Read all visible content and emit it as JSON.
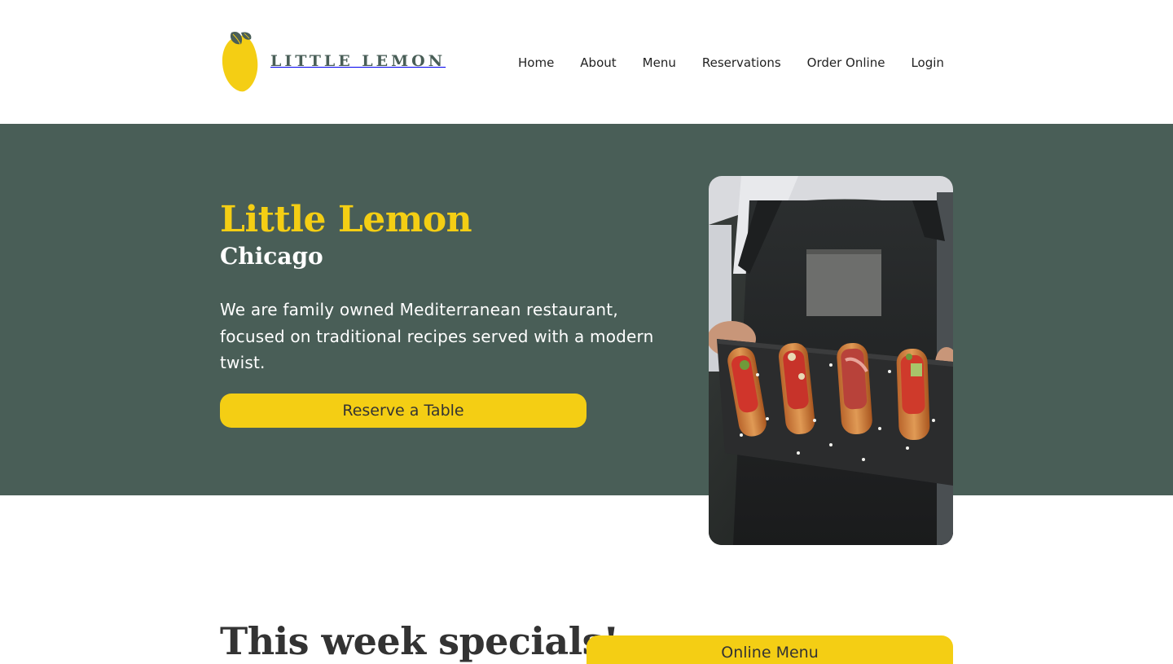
{
  "header": {
    "logo": {
      "text": "LITTLE LEMON",
      "icon": "lemon-logo-icon"
    },
    "nav": [
      {
        "label": "Home"
      },
      {
        "label": "About"
      },
      {
        "label": "Menu"
      },
      {
        "label": "Reservations"
      },
      {
        "label": "Order Online"
      },
      {
        "label": "Login"
      }
    ]
  },
  "hero": {
    "title": "Little Lemon",
    "subtitle": "Chicago",
    "description": "We are family owned Mediterranean restaurant, focused on traditional recipes served with a modern twist.",
    "cta_label": "Reserve a Table",
    "image_icon": "food-platter-photo"
  },
  "specials": {
    "title": "This week specials!",
    "menu_button_label": "Online Menu"
  },
  "colors": {
    "primary_green": "#495E57",
    "primary_yellow": "#F4CE14",
    "text_dark": "#333333",
    "background": "#FFFFFF"
  }
}
